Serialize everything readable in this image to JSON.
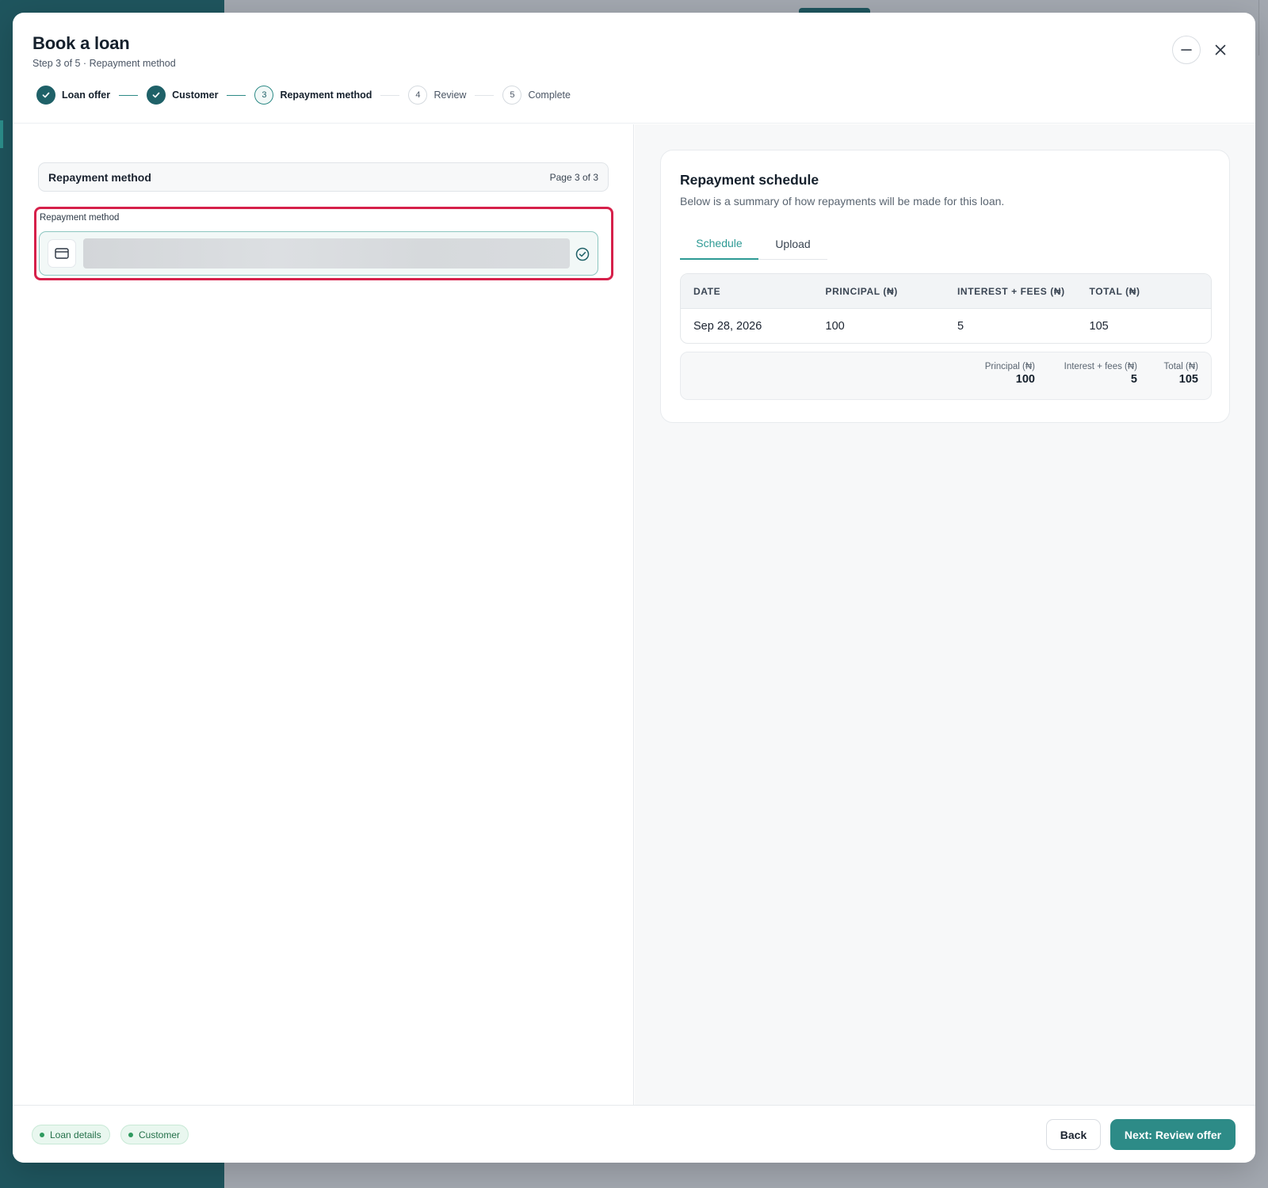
{
  "modal": {
    "title": "Book a loan",
    "subtitle": "Step 3 of 5 · Repayment method"
  },
  "stepper": {
    "steps": [
      {
        "number": "1",
        "label": "Loan offer",
        "state": "done"
      },
      {
        "number": "2",
        "label": "Customer",
        "state": "done"
      },
      {
        "number": "3",
        "label": "Repayment method",
        "state": "active"
      },
      {
        "number": "4",
        "label": "Review",
        "state": "upcoming"
      },
      {
        "number": "5",
        "label": "Complete",
        "state": "upcoming"
      }
    ]
  },
  "form": {
    "section_title": "Repayment method",
    "page_indicator": "Page 3 of 3",
    "field_label": "Repayment method",
    "field_icon": "card-icon",
    "field_status_icon": "check-circle-icon"
  },
  "schedule": {
    "title": "Repayment schedule",
    "subtitle": "Below is a summary of how repayments will be made for this loan.",
    "tabs": [
      "Schedule",
      "Upload"
    ],
    "active_tab": "Schedule",
    "columns": [
      "DATE",
      "PRINCIPAL (₦)",
      "INTEREST + FEES (₦)",
      "TOTAL (₦)"
    ],
    "rows": [
      [
        "Sep 28, 2026",
        "100",
        "5",
        "105"
      ]
    ],
    "totals": {
      "principal_label": "Principal (₦)",
      "principal_value": "100",
      "interest_label": "Interest + fees (₦)",
      "interest_value": "5",
      "total_label": "Total (₦)",
      "total_value": "105"
    }
  },
  "footer": {
    "chips": [
      "Loan details",
      "Customer"
    ],
    "back_label": "Back",
    "next_label": "Next: Review offer"
  },
  "colors": {
    "accent": "#2d8b87",
    "sidebar": "#1f555e",
    "highlight_border": "#d6204a"
  }
}
